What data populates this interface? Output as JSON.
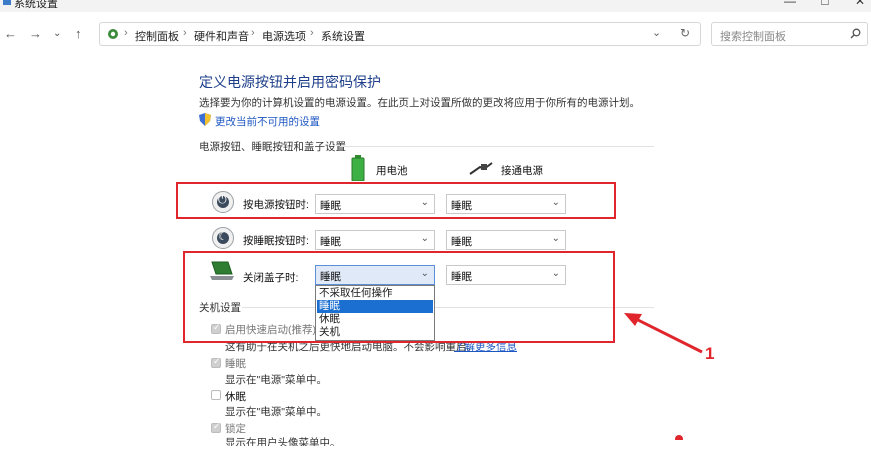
{
  "window": {
    "title": "系统设置"
  },
  "nav": {
    "breadcrumb": [
      "控制面板",
      "硬件和声音",
      "电源选项",
      "系统设置"
    ],
    "search_placeholder": "搜索控制面板"
  },
  "page": {
    "heading": "定义电源按钮并启用密码保护",
    "description": "选择要为你的计算机设置的电源设置。在此页上对设置所做的更改将应用于你所有的电源计划。",
    "change_settings_link": "更改当前不可用的设置",
    "section_buttons_title": "电源按钮、睡眠按钮和盖子设置",
    "col_battery": "用电池",
    "col_plugged": "接通电源",
    "rows": [
      {
        "label": "按电源按钮时:",
        "battery": "睡眠",
        "plugged": "睡眠"
      },
      {
        "label": "按睡眠按钮时:",
        "battery": "睡眠",
        "plugged": "睡眠"
      },
      {
        "label": "关闭盖子时:",
        "battery": "睡眠",
        "plugged": "睡眠"
      }
    ],
    "lid_dropdown_options": [
      "不采取任何操作",
      "睡眠",
      "休眠",
      "关机"
    ],
    "lid_dropdown_selected_index": 1,
    "shutdown_section_title": "关机设置",
    "shutdown_items": [
      {
        "label": "启用快速启动(推荐)",
        "checked": true,
        "disabled": true,
        "note": "这有助于在关机之后更快地启动电脑。不会影响重启。",
        "note_link": "了解更多信息"
      },
      {
        "label": "睡眠",
        "checked": true,
        "disabled": true,
        "note": "显示在\"电源\"菜单中。"
      },
      {
        "label": "休眠",
        "checked": false,
        "disabled": false,
        "note": "显示在\"电源\"菜单中。"
      },
      {
        "label": "锁定",
        "checked": true,
        "disabled": true,
        "note": "显示在用户头像菜单中。"
      }
    ]
  },
  "annotations": {
    "arrow1_label": "1",
    "accent_color": "#e0252c"
  }
}
